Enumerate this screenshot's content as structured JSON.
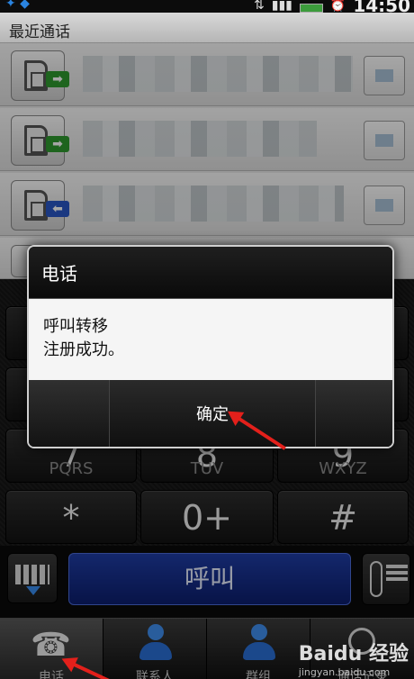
{
  "status_bar": {
    "time": "14:50"
  },
  "title_bar": {
    "title": "最近通话"
  },
  "call_log": {
    "rows": [
      {
        "direction": "outgoing",
        "direction_icon": "outgoing-call-arrow-icon",
        "badge_color": "#2f9a2f"
      },
      {
        "direction": "outgoing",
        "direction_icon": "outgoing-call-arrow-icon",
        "badge_color": "#2f9a2f"
      },
      {
        "direction": "incoming",
        "direction_icon": "incoming-call-arrow-icon",
        "badge_color": "#2856c7"
      }
    ]
  },
  "keypad": {
    "keys": [
      {
        "main": "7",
        "sub": "PQRS"
      },
      {
        "main": "8",
        "sub": "TUV"
      },
      {
        "main": "9",
        "sub": "WXYZ"
      },
      {
        "main": "*",
        "sub": ""
      },
      {
        "main": "0+",
        "sub": ""
      },
      {
        "main": "#",
        "sub": ""
      }
    ]
  },
  "call_bar": {
    "call_label": "呼叫"
  },
  "tabs": [
    {
      "label": "电话",
      "icon": "phone-icon",
      "active": true
    },
    {
      "label": "联系人",
      "icon": "person-icon",
      "active": false
    },
    {
      "label": "群组",
      "icon": "group-icon",
      "active": false
    },
    {
      "label": "通话记录",
      "icon": "history-icon",
      "active": false
    }
  ],
  "dialog": {
    "title": "电话",
    "message": "呼叫转移\n注册成功。",
    "ok_label": "确定"
  },
  "watermark": {
    "brand": "Baidu 经验",
    "url": "jingyan.baidu.com"
  },
  "colors": {
    "call_button": "#1f3da6",
    "annotation_arrow": "#e3201b",
    "dialog_body": "#f5f5f5"
  }
}
